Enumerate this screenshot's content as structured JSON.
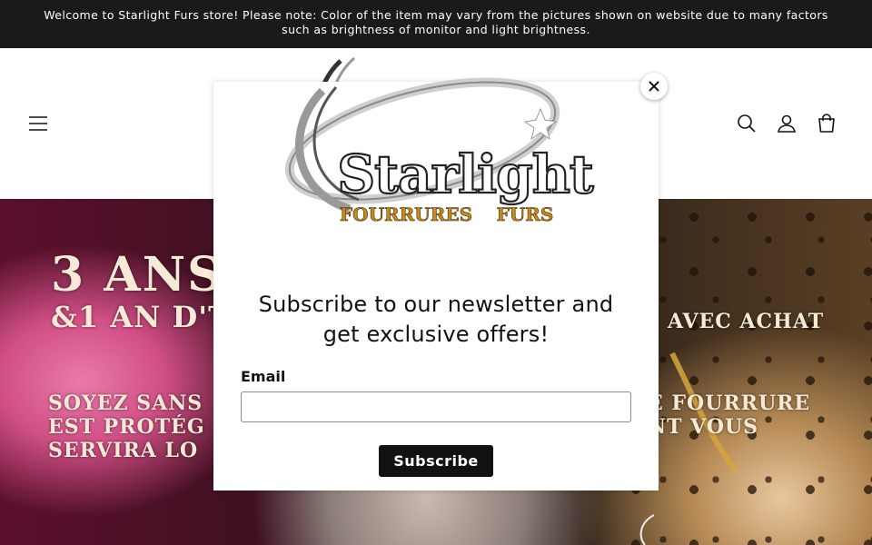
{
  "announcement": {
    "text": "Welcome to Starlight Furs store! Please note: Color of the item may vary from the pictures shown on website due to many factors such as brightness of monitor and light brightness."
  },
  "header": {
    "icons": [
      "menu-icon",
      "search-icon",
      "account-icon",
      "cart-icon"
    ],
    "logo": {
      "word": "Starlight",
      "sub_left": "FOURRURES",
      "sub_right": "FURS"
    }
  },
  "hero": {
    "line1": "3 ANS",
    "line2": "&1 AN D'T",
    "line3": "SOYEZ SANS\nEST PROTÉG\nSERVIRA LO",
    "right1": "AVEC ACHAT",
    "right2": "E FOURRURE\nNT VOUS"
  },
  "modal": {
    "logo": {
      "word": "Starlight",
      "sub_left": "FOURRURES",
      "sub_right": "FURS"
    },
    "title": "Subscribe to our newsletter and get exclusive offers!",
    "email_label": "Email",
    "email_value": "",
    "subscribe_label": "Subscribe",
    "close_icon": "close-icon"
  },
  "colors": {
    "announcement_bg": "#1a1a1a",
    "button_bg": "#111111",
    "logo_gold": "#c98a1c"
  }
}
